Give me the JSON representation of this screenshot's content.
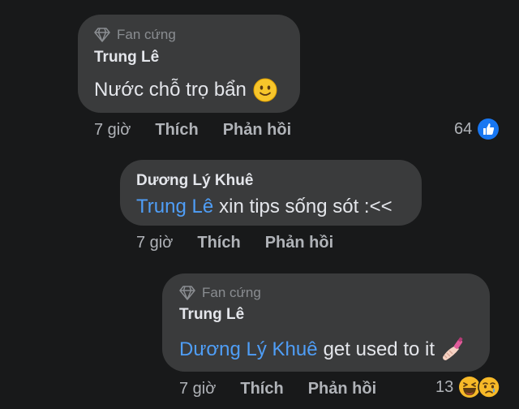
{
  "comments": [
    {
      "badge": "Fan cứng",
      "author": "Trung Lê",
      "mention": "",
      "text": "Nước chỗ trọ bẩn",
      "emoji": "slightly-smiling-face",
      "time": "7 giờ",
      "like_label": "Thích",
      "reply_label": "Phản hồi",
      "reaction_count": "64",
      "reactions": [
        "like"
      ]
    },
    {
      "badge": "",
      "author": "Dương Lý Khuê",
      "mention": "Trung Lê",
      "text": "xin tips sống sót :<<",
      "emoji": "",
      "time": "7 giờ",
      "like_label": "Thích",
      "reply_label": "Phản hồi",
      "reaction_count": "",
      "reactions": []
    },
    {
      "badge": "Fan cứng",
      "author": "Trung Lê",
      "mention": "Dương Lý Khuê",
      "text": "get used to it",
      "emoji": "nail-polish",
      "time": "7 giờ",
      "like_label": "Thích",
      "reply_label": "Phản hồi",
      "reaction_count": "13",
      "reactions": [
        "haha",
        "sad"
      ]
    }
  ],
  "colors": {
    "background": "#18191a",
    "bubble": "#3a3b3c",
    "mention": "#4f9ef7",
    "like_blue": "#1877f2",
    "secondary_text": "#b0b3b8"
  }
}
